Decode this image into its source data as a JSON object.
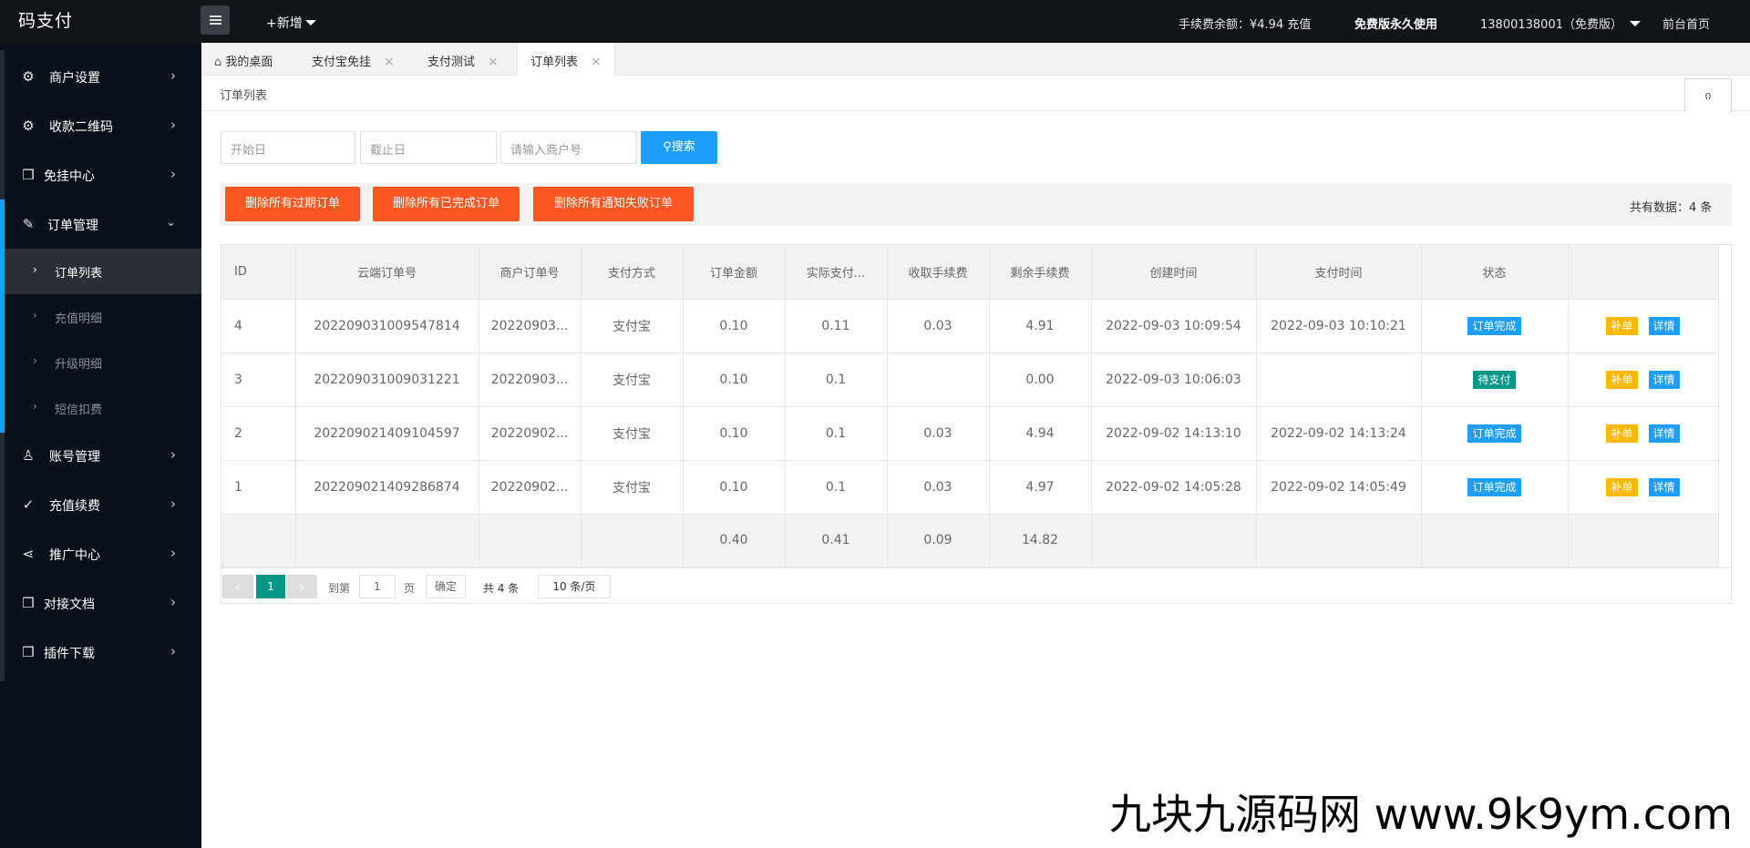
{
  "app": {
    "logo": "码支付",
    "add_new": "+新增",
    "fee_balance": "手续费余额：¥4.94 充值",
    "free_version": "免费版永久使用",
    "account": "13800138001（免费版）",
    "front_home": "前台首页"
  },
  "sidebar": {
    "items": [
      {
        "label": "商户设置",
        "icon": "gear-icon"
      },
      {
        "label": "收款二维码",
        "icon": "gear-icon"
      },
      {
        "label": "免挂中心",
        "icon": "cube-icon"
      },
      {
        "label": "订单管理",
        "icon": "edit-icon"
      },
      {
        "label": "账号管理",
        "icon": "user-icon"
      },
      {
        "label": "充值续费",
        "icon": "check-icon"
      },
      {
        "label": "推广中心",
        "icon": "share-icon"
      },
      {
        "label": "对接文档",
        "icon": "cube-icon"
      },
      {
        "label": "插件下载",
        "icon": "cube-icon"
      }
    ],
    "sub_items": [
      {
        "label": "订单列表",
        "active": true
      },
      {
        "label": "充值明细",
        "active": false
      },
      {
        "label": "升级明细",
        "active": false
      },
      {
        "label": "短信扣费",
        "active": false
      }
    ]
  },
  "tabs": [
    {
      "label": "我的桌面",
      "icon": "home-icon"
    },
    {
      "label": "支付宝免挂"
    },
    {
      "label": "支付测试"
    },
    {
      "label": "订单列表",
      "active": true
    }
  ],
  "page": {
    "title": "订单列表",
    "refresh_glyph": "ი"
  },
  "filters": {
    "start_placeholder": "开始日",
    "end_placeholder": "截止日",
    "merchant_placeholder": "请输入商户号",
    "search_label": "搜索"
  },
  "actions": {
    "delete_expired": "删除所有过期订单",
    "delete_completed": "删除所有已完成订单",
    "delete_notify_failed": "删除所有通知失败订单",
    "total_text": "共有数据：4 条"
  },
  "table": {
    "headers": [
      "ID",
      "云端订单号",
      "商户订单号",
      "支付方式",
      "订单金额",
      "实际支付...",
      "收取手续费",
      "剩余手续费",
      "创建时间",
      "支付时间",
      "状态",
      ""
    ],
    "rows": [
      {
        "id": "4",
        "cloud_no": "202209031009547814",
        "merchant_no": "20220903...",
        "pay_type": "支付宝",
        "amount": "0.10",
        "actual": "0.11",
        "fee": "0.03",
        "remain_fee": "4.91",
        "created": "2022-09-03 10:09:54",
        "paid": "2022-09-03 10:10:21",
        "status": "订单完成",
        "status_type": "done"
      },
      {
        "id": "3",
        "cloud_no": "202209031009031221",
        "merchant_no": "20220903...",
        "pay_type": "支付宝",
        "amount": "0.10",
        "actual": "0.1",
        "fee": "",
        "remain_fee": "0.00",
        "created": "2022-09-03 10:06:03",
        "paid": "",
        "status": "待支付",
        "status_type": "pending"
      },
      {
        "id": "2",
        "cloud_no": "202209021409104597",
        "merchant_no": "20220902...",
        "pay_type": "支付宝",
        "amount": "0.10",
        "actual": "0.1",
        "fee": "0.03",
        "remain_fee": "4.94",
        "created": "2022-09-02 14:13:10",
        "paid": "2022-09-02 14:13:24",
        "status": "订单完成",
        "status_type": "done"
      },
      {
        "id": "1",
        "cloud_no": "202209021409286874",
        "merchant_no": "20220902...",
        "pay_type": "支付宝",
        "amount": "0.10",
        "actual": "0.1",
        "fee": "0.03",
        "remain_fee": "4.97",
        "created": "2022-09-02 14:05:28",
        "paid": "2022-09-02 14:05:49",
        "status": "订单完成",
        "status_type": "done"
      }
    ],
    "op_reissue": "补单",
    "op_detail": "详情",
    "totals": {
      "amount": "0.40",
      "actual": "0.41",
      "fee": "0.09",
      "remain_fee": "14.82"
    }
  },
  "pager": {
    "current": "1",
    "goto_label": "到第",
    "goto_value": "1",
    "page_unit": "页",
    "confirm": "确定",
    "total": "共 4 条",
    "page_size": "10 条/页"
  },
  "watermark": "九块九源码网 www.9k9ym.com",
  "colors": {
    "accent_blue": "#1e9fff",
    "danger_orange": "#ff5722",
    "success_teal": "#009688",
    "warn_yellow": "#ffb800",
    "sidebar_bg": "#0b111a"
  }
}
